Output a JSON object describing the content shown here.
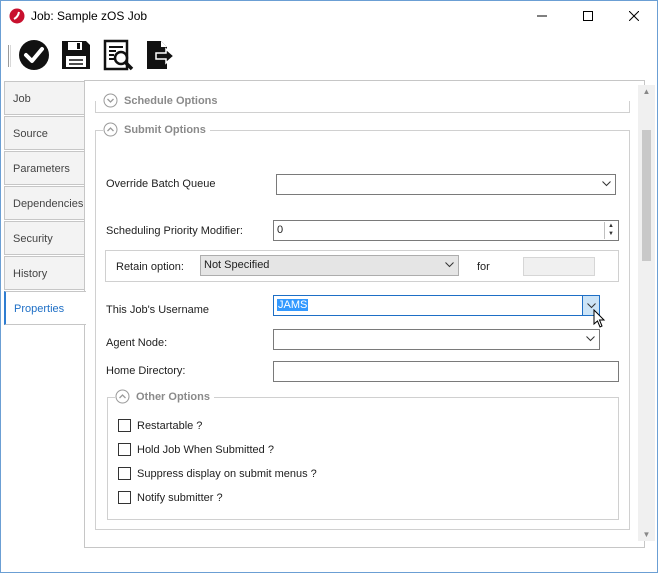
{
  "window": {
    "title": "Job: Sample zOS Job"
  },
  "toolbar": {
    "buttons": [
      {
        "name": "save-close",
        "icon": "checkmark-circle-icon"
      },
      {
        "name": "save",
        "icon": "floppy-disk-icon"
      },
      {
        "name": "view-source",
        "icon": "document-search-icon"
      },
      {
        "name": "export",
        "icon": "export-document-icon"
      }
    ]
  },
  "tabs": [
    "Job",
    "Source",
    "Parameters",
    "Dependencies",
    "Security",
    "History",
    "Properties"
  ],
  "active_tab": "Properties",
  "schedule_options": {
    "title": "Schedule Options"
  },
  "submit_options": {
    "title": "Submit Options",
    "override_batch_queue": {
      "label": "Override Batch Queue",
      "value": ""
    },
    "scheduling_priority": {
      "label": "Scheduling Priority Modifier:",
      "value": "0"
    },
    "retain_option": {
      "label": "Retain option:",
      "value": "Not Specified",
      "for_label": "for",
      "for_value": ""
    },
    "username": {
      "label": "This Job's Username",
      "value": "JAMS"
    },
    "agent_node": {
      "label": "Agent Node:",
      "value": ""
    },
    "home_directory": {
      "label": "Home Directory:",
      "value": ""
    }
  },
  "other_options": {
    "title": "Other Options",
    "checkboxes": [
      {
        "label": "Restartable ?",
        "checked": false
      },
      {
        "label": "Hold Job When Submitted ?",
        "checked": false
      },
      {
        "label": "Suppress display on submit menus ?",
        "checked": false
      },
      {
        "label": "Notify submitter ?",
        "checked": false
      }
    ]
  },
  "colors": {
    "accent": "#1e6fc6",
    "selection": "#3399ff",
    "app_icon_red": "#c8102e"
  }
}
